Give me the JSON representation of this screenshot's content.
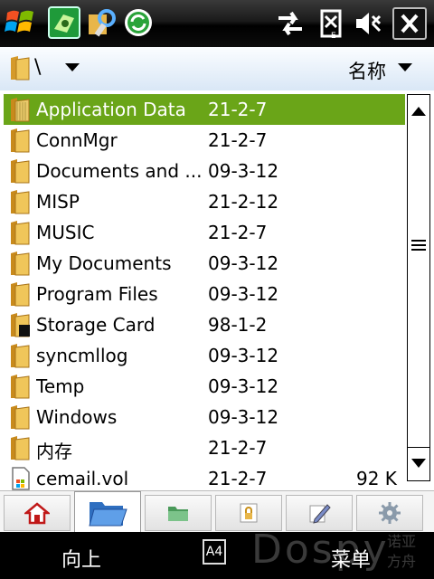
{
  "path": {
    "text": "\\"
  },
  "sort": {
    "label": "名称"
  },
  "files": [
    {
      "name": "Application Data",
      "date": "21-2-7",
      "size": "",
      "icon": "folder-icon",
      "selected": true
    },
    {
      "name": "ConnMgr",
      "date": "21-2-7",
      "size": "",
      "icon": "folder-icon"
    },
    {
      "name": "Documents and ...",
      "date": "09-3-12",
      "size": "",
      "icon": "folder-icon"
    },
    {
      "name": "MISP",
      "date": "21-2-12",
      "size": "",
      "icon": "folder-icon"
    },
    {
      "name": "MUSIC",
      "date": "21-2-7",
      "size": "",
      "icon": "folder-icon"
    },
    {
      "name": "My Documents",
      "date": "09-3-12",
      "size": "",
      "icon": "folder-icon"
    },
    {
      "name": "Program Files",
      "date": "09-3-12",
      "size": "",
      "icon": "folder-icon"
    },
    {
      "name": "Storage Card",
      "date": "98-1-2",
      "size": "",
      "icon": "storage-card-folder-icon"
    },
    {
      "name": "syncmllog",
      "date": "09-3-12",
      "size": "",
      "icon": "folder-icon"
    },
    {
      "name": "Temp",
      "date": "09-3-12",
      "size": "",
      "icon": "folder-icon"
    },
    {
      "name": "Windows",
      "date": "09-3-12",
      "size": "",
      "icon": "folder-icon"
    },
    {
      "name": "内存",
      "date": "21-2-7",
      "size": "",
      "icon": "folder-icon"
    },
    {
      "name": "cemail.vol",
      "date": "21-2-7",
      "size": "92 K",
      "icon": "file-icon"
    }
  ],
  "tabs": [
    {
      "icon": "home-icon",
      "active": false
    },
    {
      "icon": "open-folder-icon",
      "active": true
    },
    {
      "icon": "folder-green-icon",
      "active": false
    },
    {
      "icon": "lock-icon",
      "active": false
    },
    {
      "icon": "edit-icon",
      "active": false
    },
    {
      "icon": "gear-icon",
      "active": false
    }
  ],
  "softkeys": {
    "left": "向上",
    "right": "菜单",
    "middle": "A4"
  },
  "watermark": {
    "text": "Dospy",
    "cn_top": "诺亚",
    "cn_bottom": "方舟"
  },
  "colors": {
    "selection": "#6aa518",
    "folder": "#e8b64a"
  }
}
